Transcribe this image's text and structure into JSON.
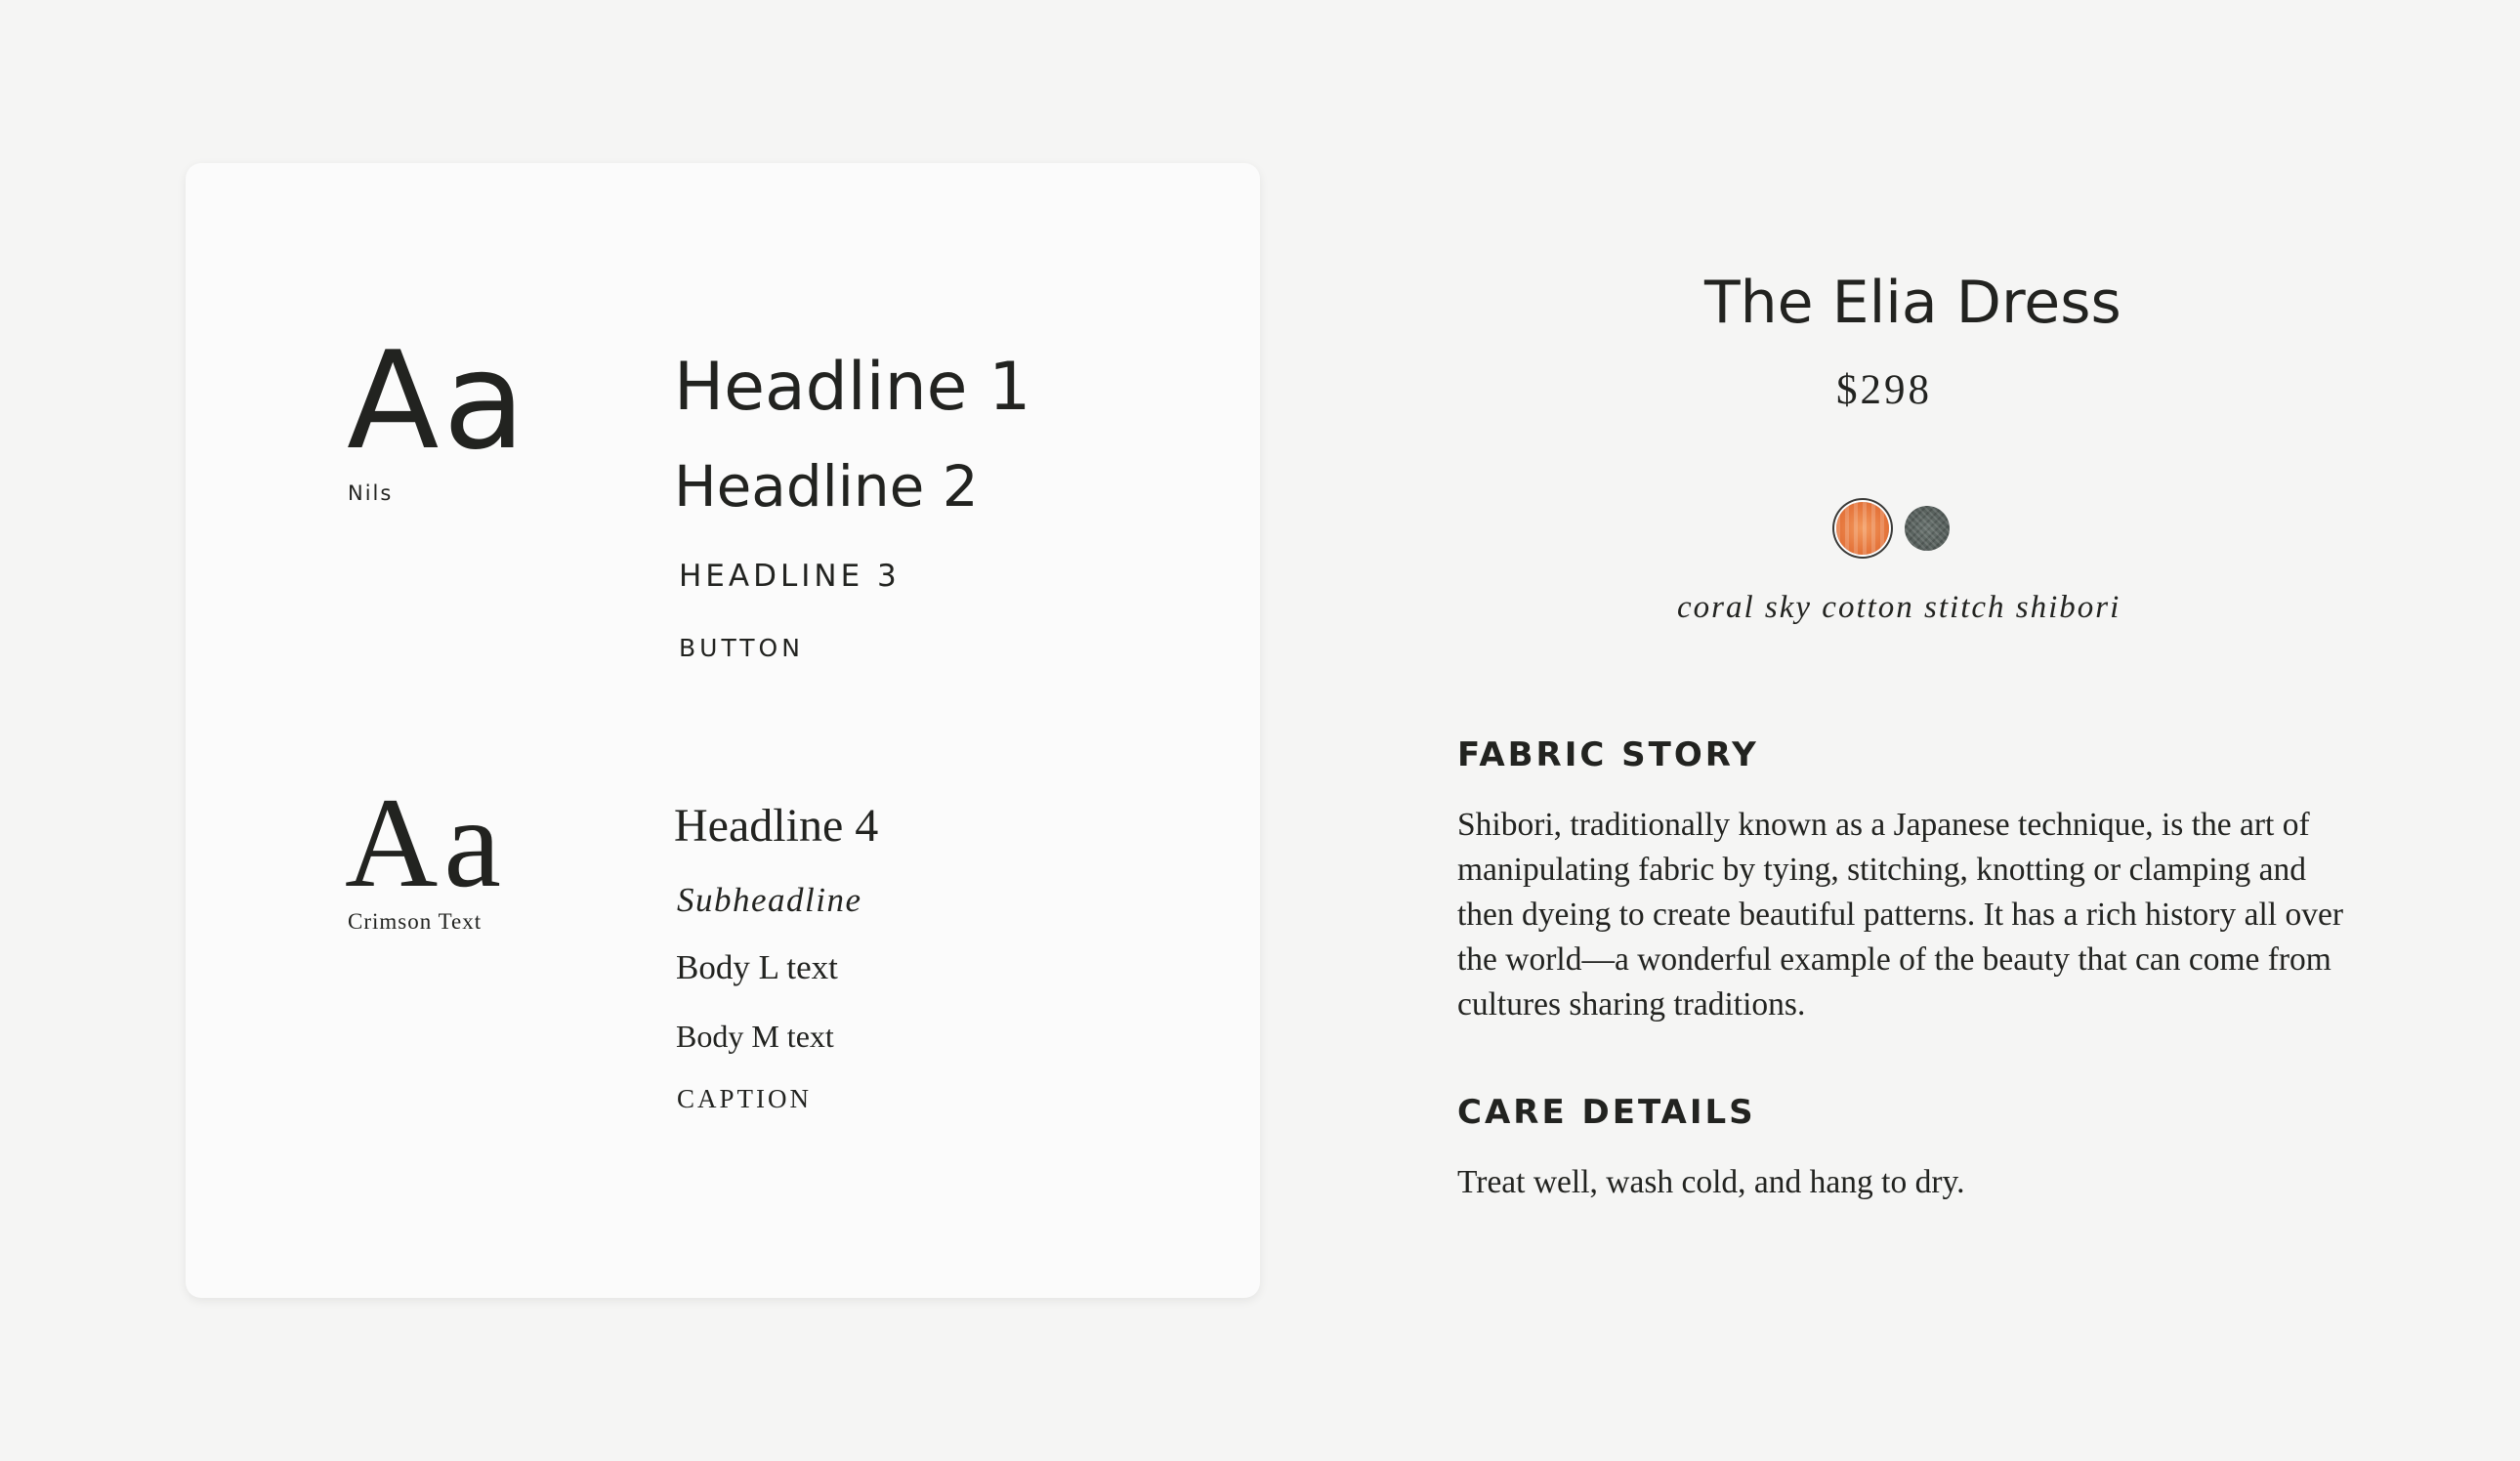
{
  "style_guide": {
    "sans_specimen": {
      "glyphs": "Aa",
      "font_name": "Nils"
    },
    "sans_samples": {
      "headline_1": "Headline 1",
      "headline_2": "Headline 2",
      "headline_3": "HEADLINE 3",
      "button": "BUTTON"
    },
    "serif_specimen": {
      "glyphs": "Aa",
      "font_name": "Crimson Text"
    },
    "serif_samples": {
      "headline_4": "Headline 4",
      "subheadline": "Subheadline",
      "body_l": "Body L text",
      "body_m": "Body M text",
      "caption": "CAPTION"
    }
  },
  "product": {
    "title": "The Elia Dress",
    "price": "$298",
    "swatches": [
      {
        "name": "coral-swatch",
        "color": "#e7793f",
        "selected": true
      },
      {
        "name": "slate-swatch",
        "color": "#525a57",
        "selected": false
      }
    ],
    "selected_color_name": "coral sky cotton stitch shibori",
    "fabric_story": {
      "heading": "FABRIC STORY",
      "text": "Shibori, traditionally known as a Japanese technique, is the art of manipulating fabric by tying, stitching, knotting or clamping and then dyeing to create beautiful patterns. It has a rich history all over the world—a wonderful example of the beauty that can come from cultures sharing traditions."
    },
    "care_details": {
      "heading": "CARE DETAILS",
      "text": "Treat well, wash cold, and hang to dry."
    }
  },
  "colors": {
    "background": "#f5f5f4",
    "card": "#fbfbfb",
    "text": "#222320"
  }
}
